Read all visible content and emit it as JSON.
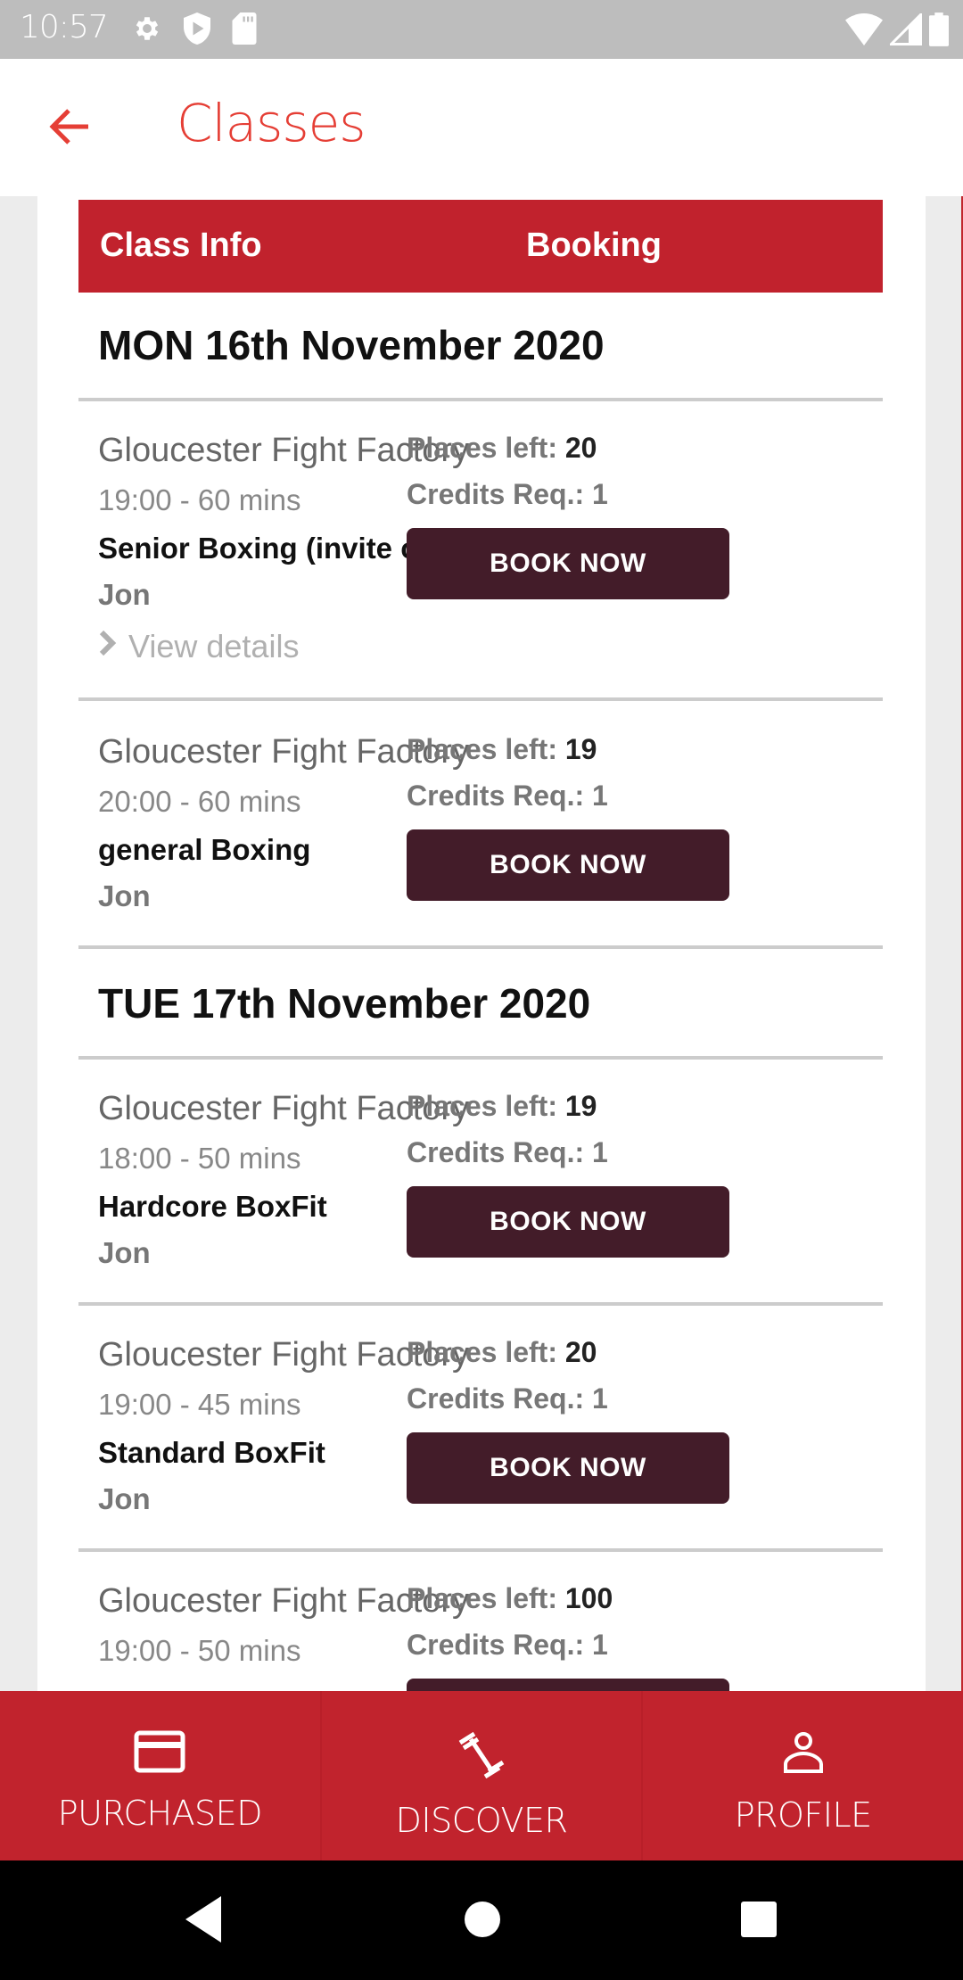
{
  "status_bar": {
    "time": "10:57",
    "left_icons": [
      "settings-icon",
      "shield-play-icon",
      "sd-card-icon"
    ],
    "right_icons": [
      "wifi-icon",
      "signal-icon",
      "battery-icon"
    ]
  },
  "app_bar": {
    "title": "Classes",
    "back_icon": "arrow-left-icon"
  },
  "colors": {
    "accent": "#e53e35",
    "header_red": "#c1222d",
    "button_dark": "#431c29",
    "nav_red": "#c1232d"
  },
  "table": {
    "headers": [
      "Class Info",
      "Booking"
    ]
  },
  "days": [
    {
      "date": "MON 16th November 2020",
      "classes": [
        {
          "venue": "Gloucester Fight Factory",
          "time": "19:00 - 60 mins",
          "name": "Senior Boxing (invite only)",
          "instructor": "Jon",
          "view_details": "View details",
          "places_label": "Places left:",
          "places": "20",
          "credits_label": "Credits Req.:",
          "credits": "1",
          "button": "BOOK NOW"
        },
        {
          "venue": "Gloucester Fight Factory",
          "time": "20:00 - 60 mins",
          "name": "general Boxing",
          "instructor": "Jon",
          "places_label": "Places left:",
          "places": "19",
          "credits_label": "Credits Req.:",
          "credits": "1",
          "button": "BOOK NOW"
        }
      ]
    },
    {
      "date": "TUE 17th November 2020",
      "classes": [
        {
          "venue": "Gloucester Fight Factory",
          "time": "18:00 - 50 mins",
          "name": "Hardcore BoxFit",
          "instructor": "Jon",
          "places_label": "Places left:",
          "places": "19",
          "credits_label": "Credits Req.:",
          "credits": "1",
          "button": "BOOK NOW"
        },
        {
          "venue": "Gloucester Fight Factory",
          "time": "19:00 - 45 mins",
          "name": "Standard BoxFit",
          "instructor": "Jon",
          "places_label": "Places left:",
          "places": "20",
          "credits_label": "Credits Req.:",
          "credits": "1",
          "button": "BOOK NOW"
        },
        {
          "venue": "Gloucester Fight Factory",
          "time": "19:00 - 50 mins",
          "places_label": "Places left:",
          "places": "100",
          "credits_label": "Credits Req.:",
          "credits": "1"
        }
      ]
    }
  ],
  "bottom_nav": [
    {
      "label": "PURCHASED",
      "icon": "credit-card-icon"
    },
    {
      "label": "DISCOVER",
      "icon": "dumbbell-icon"
    },
    {
      "label": "PROFILE",
      "icon": "person-icon"
    }
  ],
  "system_nav": [
    "back-triangle-icon",
    "home-circle-icon",
    "recents-square-icon"
  ]
}
